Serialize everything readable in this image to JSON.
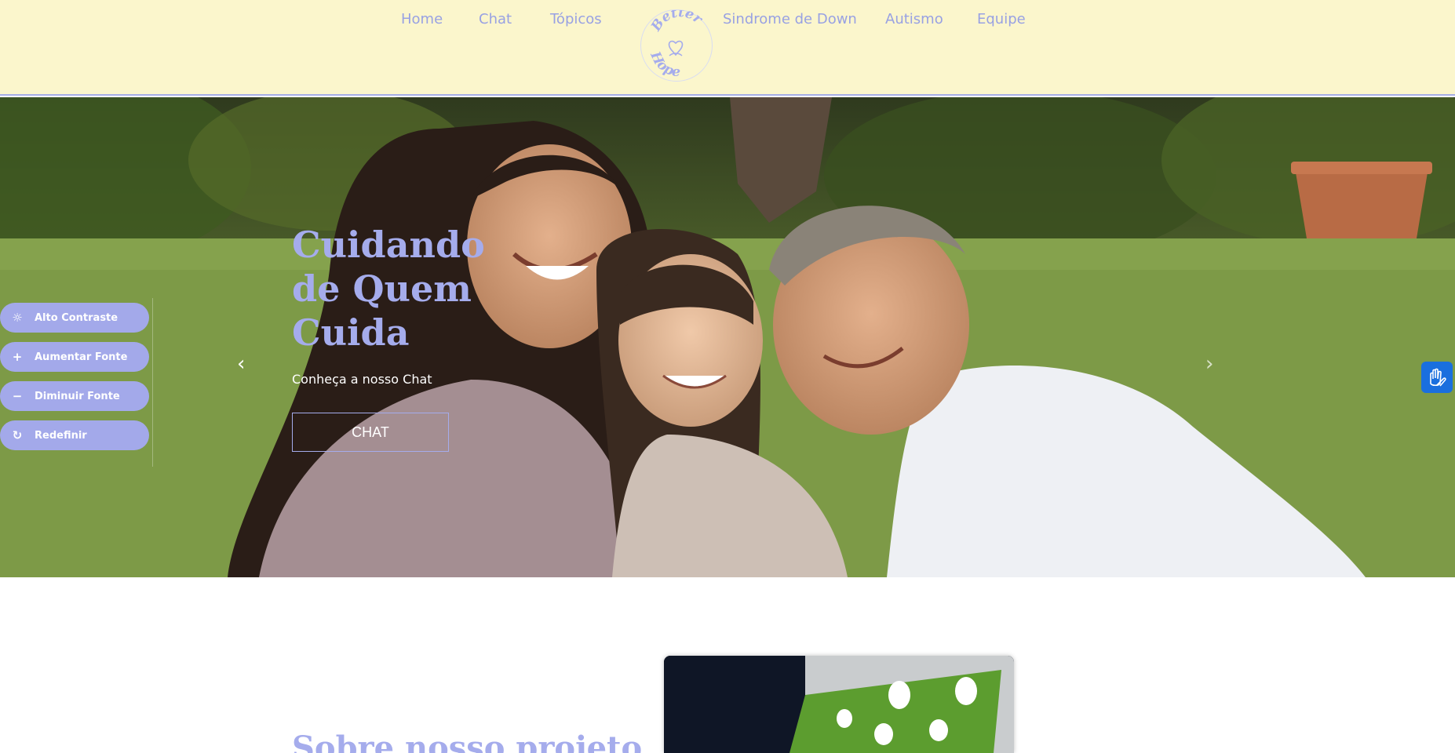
{
  "nav": {
    "left": [
      "Home",
      "Chat",
      "Tópicos"
    ],
    "right": [
      "Sindrome de Down",
      "Autismo",
      "Equipe"
    ],
    "logo_text": "Better Hope"
  },
  "hero": {
    "title_lines": [
      "Cuidando",
      "de Quem",
      "Cuida"
    ],
    "subtitle": "Conheça a nosso Chat",
    "button": "CHAT",
    "prev_icon": "chevron-left-icon",
    "next_icon": "chevron-right-icon"
  },
  "accessibility": [
    {
      "label": "Alto Contraste",
      "icon": "contrast-icon"
    },
    {
      "label": "Aumentar Fonte",
      "icon": "plus-icon"
    },
    {
      "label": "Diminuir Fonte",
      "icon": "minus-icon"
    },
    {
      "label": "Redefinir",
      "icon": "refresh-icon"
    }
  ],
  "libras_icon": "sign-language-icon",
  "about": {
    "title": "Sobre nosso projeto"
  },
  "colors": {
    "header_bg": "#fbf6cc",
    "accent": "#a5acec",
    "nav_text": "#98a1e3",
    "libras_bg": "#1a6fde"
  }
}
